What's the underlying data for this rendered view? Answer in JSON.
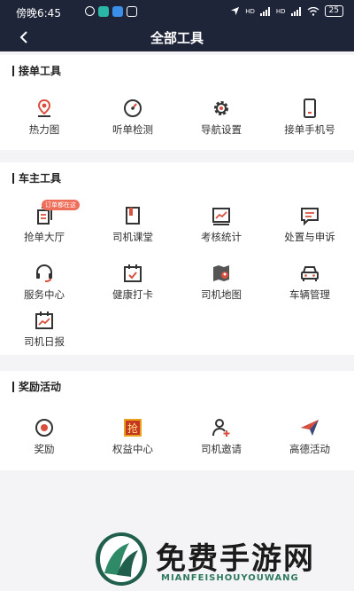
{
  "status_bar": {
    "time": "傍晚6:45",
    "network_1": "HD",
    "network_2": "HD",
    "battery": "25"
  },
  "nav": {
    "title": "全部工具"
  },
  "sections": [
    {
      "title": "接单工具",
      "items": [
        {
          "label": "热力图",
          "icon": "map-pin-icon"
        },
        {
          "label": "听单检测",
          "icon": "gauge-icon"
        },
        {
          "label": "导航设置",
          "icon": "gear-icon"
        },
        {
          "label": "接单手机号",
          "icon": "phone-icon"
        }
      ]
    },
    {
      "title": "车主工具",
      "items": [
        {
          "label": "抢单大厅",
          "icon": "document-icon",
          "badge": "订单都在这"
        },
        {
          "label": "司机课堂",
          "icon": "book-icon"
        },
        {
          "label": "考核统计",
          "icon": "chart-icon"
        },
        {
          "label": "处置与申诉",
          "icon": "message-icon"
        },
        {
          "label": "服务中心",
          "icon": "headset-icon"
        },
        {
          "label": "健康打卡",
          "icon": "calendar-check-icon"
        },
        {
          "label": "司机地图",
          "icon": "driver-map-icon"
        },
        {
          "label": "车辆管理",
          "icon": "car-icon"
        },
        {
          "label": "司机日报",
          "icon": "daily-report-icon"
        }
      ]
    },
    {
      "title": "奖励活动",
      "items": [
        {
          "label": "奖励",
          "icon": "target-icon"
        },
        {
          "label": "权益中心",
          "icon": "grab-badge-icon",
          "icon_text": "抢"
        },
        {
          "label": "司机邀请",
          "icon": "invite-user-icon"
        },
        {
          "label": "高德活动",
          "icon": "paper-plane-icon"
        }
      ]
    }
  ],
  "watermark": {
    "title": "免费手游网",
    "subtitle": "MIANFEISHOUYOUWANG"
  },
  "colors": {
    "header": "#1f2539",
    "accent": "#d9503f",
    "badge": "#ef6e5a"
  }
}
